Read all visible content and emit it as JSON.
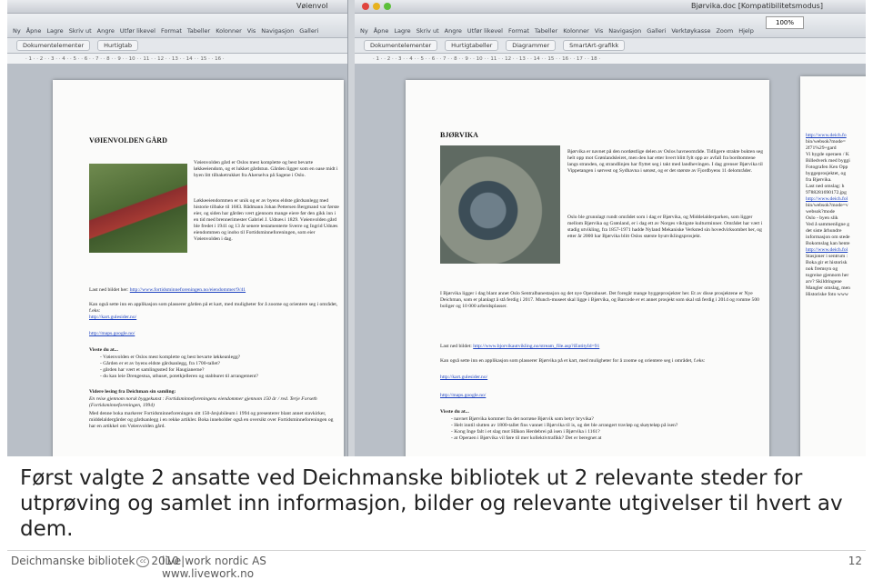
{
  "left_window": {
    "title": "Vøienvol",
    "toolbar": [
      "Ny",
      "Åpne",
      "Lagre",
      "Skriv ut",
      "Angre",
      "Utfør likevel",
      "Format",
      "Tabeller",
      "Kolonner",
      "Vis",
      "Navigasjon",
      "Galleri"
    ],
    "ribbon": [
      "Dokumentelementer",
      "Hurtigtab"
    ],
    "ruler": "· 1 · · 2 · · 3 · · 4 · · 5 · · 6 · · 7 · · 8 · · 9 · · 10 · · 11 · · 12 · · 13 · · 14 · · 15 · · 16 ·",
    "doc": {
      "heading": "VØIENVOLDEN GÅRD",
      "intro": "Vøienvolden gård er Oslos mest komplette og best bevarte løkkeeiendom, og et lukket gårdstun. Gården ligger som en oase midt i byen litt tilbaketrukket fra Akerselva på Sagene i Oslo.",
      "body": "Løkkeeiendommen er unik og er av byens eldste gårdsanlegg med historie tilbake til 1683. Rådmann Johan Pettersen Bergmand var første eier, og siden har gården vært gjennom mange eiere før den gikk inn i en tid med brennerimester Gabriel J. Udnæs i 1829. Vøienvolden gård ble fredet i 1941 og 13 år senere testamenterte Sverre og Ingrid Udnæs eiendommen og inobo til Fortidsminneforeningen, som eier Vøienvolden i dag.",
      "last_ned": "Last ned bildet her:",
      "link1": "http://www.fortidsminneforeningen.no/eiendommer/9/41",
      "kart_text": "Kan også sette inn en applikasjon som plasserer gården på et kart, med muligheter for å zoome og orientere seg i området, f.eks:",
      "link2": "http://kart.gulesider.no/",
      "link3": "http://maps.google.no/",
      "visste": "Visste du at...",
      "bullets": [
        "Vøienvolden er Oslos mest komplette og best bevarte løkkeanlegg?",
        "Gården er et av byens eldste gårdsanlegg, fra 1700-tallet?",
        "gården har vært et samlingssted for Haugianerne?",
        "du kan leie Drengestua, uthuset, potetkjelleren og stabburet til arrangement?"
      ],
      "videre": "Videre lesing fra Deichman sin samling:",
      "lit": "En reise gjennom norsk byggekunst : Fortidsminneforeningens eiendommer gjennom 150 år / red. Terje Forseth (Fortidsminneforeningen, 1994)",
      "lit2": "Med denne boka markerer Fortidsminneforeningen sitt 150-årsjubileum i 1994 og presenterer blant annet stavkirker, middelaldergårder og gårdsanlegg i en rekke artikler. Boka inneholder også en oversikt over Fortidsminneforeningen og har en artikkel om Vøienvolden gård."
    }
  },
  "right_window": {
    "title": "Bjørvika.doc [Kompatibilitetsmodus]",
    "toolbar": [
      "Ny",
      "Åpne",
      "Lagre",
      "Skriv ut",
      "Angre",
      "Utfør likevel",
      "Format",
      "Tabeller",
      "Kolonner",
      "Vis",
      "Navigasjon",
      "Galleri",
      "Verktøykasse",
      "Zoom",
      "Hjelp"
    ],
    "zoom": "100%",
    "ribbon": [
      "Dokumentelementer",
      "Hurtigtabeller",
      "Diagrammer",
      "SmartArt-grafikk"
    ],
    "ruler": "· 1 · · 2 · · 3 · · 4 · · 5 · · 6 · · 7 · · 8 · · 9 · · 10 · · 11 · · 12 · · 13 · · 14 · · 15 · · 16 · · 17 · · 18 ·",
    "doc": {
      "heading": "BJØRVIKA",
      "intro": "Bjørvika er navnet på den nordøstlige delen av Oslos havneområde. Tidligere strakte bukten seg helt opp mot Grønlandsleiret, men den har etter hvert blitt fylt opp av avfall fra bordtomtene langs stranden, og strandlinjen har flyttet seg i takt med landhevingen. I dag grenser Bjørvika til Vippetangen i sørvest og Sydhavna i sørøst, og er det største av Fjordbyens 11 delområder.",
      "plan": "Oslo ble grunnlagt rundt området som i dag er Bjørvika, og Middelalderparken, som ligger mellom Bjørvika og Grønland, er i dag ett av Norges viktigste kulturminner. Området har vært i stadig utvikling, fra 1857-1971 hadde Nyland Mekaniske Verksted sin hovedvirksombet her, og etter år 2000 har Bjørvika blitt Oslos største byutviklingsprosjekt.",
      "deich": "I Bjørvika ligger i dag blant annet Oslo Sentralbanestasjon og det nye Operahuset. Det foregår mange byggeprosjekter her. Et av disse prosjektene er Nye Deichman, som er planlagt å stå ferdig i 2017. Munch-museet skal ligge i Bjørvika, og Barcode er et annet prosjekt som skal stå ferdig i 2014 og romme 500 boliger og 10 000 arbeidsplasser.",
      "last_ned": "Last ned bildet:",
      "link1": "http://www.bjorvikautvikling.no/stream_file.asp?iEntityId=91",
      "kart_text": "Kan også sette inn en applikasjon som plasserer Bjørvika på et kart, med muligheter for å zoome og orientere seg i området, f.eks:",
      "link2": "http://kart.gulesider.no/",
      "link3": "http://maps.google.no/",
      "visste": "Visste du at...",
      "bullets": [
        "navnet Bjørvika kommer fra det norrøne Bjørvik som betyr bryvika?",
        "Helt inntil slutten av 1800-tallet fins vannet i Bjørvika til is, og det ble arrangert travløp og skøyteløp på isen?",
        "Kong Inge falt i et slag mot Håkon Herdebrei på isen i Bjørvika i 1161?",
        "at Operaen i Bjørvika vil føre til mer kollektivtrafikk? Det er beregnet at"
      ]
    },
    "side": {
      "lines": [
        "http://www.deich.fo",
        "bin/websok?mode=",
        "2f71%29+gard",
        "Vi bygde operaen / K",
        "Billedverk med byggi",
        "Fotografen Ken Opp",
        "byggeprosjektet, og",
        "fra Bjørvika.",
        "Last ned omslag: h",
        "9788281690172.jpg",
        "http://www.deich.fol",
        "bin/websok?mode=v",
        "websok?mode",
        "Oslo - byen slik",
        "Ved å sammenligne g",
        "det siste århundre",
        "informasjon om stede",
        "Bokomslag kan hente",
        "http://www.deich.fol",
        "Stasjoner i sentrum :",
        "Boka gir et historisk",
        "nok fremsyn og",
        "togreise gjennom her",
        "arv? Skildringene",
        "Mangler omslag, men",
        "Historiske foto www"
      ]
    }
  },
  "slide": {
    "caption": "Først valgte 2 ansatte ved Deichmanske bibliotek ut 2 relevante steder for utprøving og samlet inn informasjon, bilder og relevante utgivelser til hvert av dem.",
    "footer_org": "Deichmanske bibliotek",
    "footer_cc": "cc",
    "footer_year": "2010",
    "footer_company": "live|work nordic AS",
    "footer_web": "www.livework.no",
    "page_number": "12"
  }
}
